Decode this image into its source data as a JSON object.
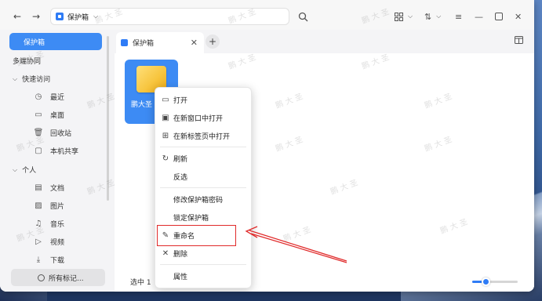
{
  "titlebar": {
    "address": "保护箱"
  },
  "sidebar": {
    "active_item": "保护箱",
    "multi_sync": "多端协同",
    "quick_access_group": "快速访问",
    "quick_access": [
      "最近",
      "桌面",
      "回收站",
      "本机共享"
    ],
    "personal_group": "个人",
    "personal": [
      "文档",
      "图片",
      "音乐",
      "视频",
      "下载"
    ],
    "all_tags": "所有标记..."
  },
  "tabs": [
    {
      "label": "保护箱"
    }
  ],
  "file": {
    "name": "鹏大圣"
  },
  "status": {
    "text": "选中 1"
  },
  "zoom": {
    "level": 0.3
  },
  "context_menu": {
    "open": "打开",
    "open_new_window": "在新窗口中打开",
    "open_new_tab": "在新标签页中打开",
    "refresh": "刷新",
    "invert_select": "反选",
    "change_password": "修改保护箱密码",
    "lock": "锁定保护箱",
    "rename": "重命名",
    "delete": "删除",
    "properties": "属性"
  },
  "watermark": {
    "text": "鹏 大 圣"
  },
  "colors": {
    "accent": "#3d8bf4",
    "highlight": "#e02a2a"
  }
}
